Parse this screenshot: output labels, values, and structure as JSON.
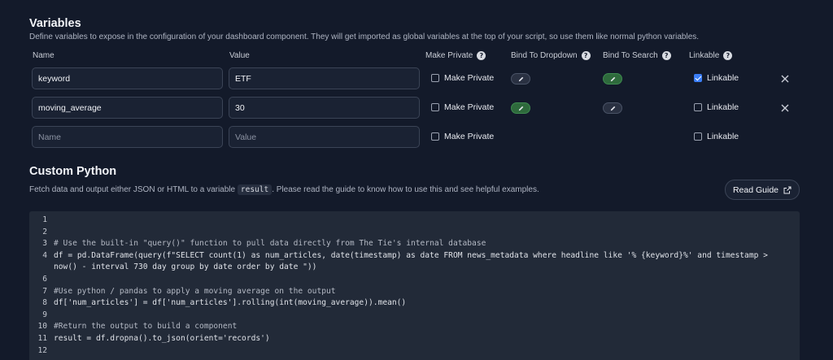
{
  "variables": {
    "title": "Variables",
    "description": "Define variables to expose in the configuration of your dashboard component. They will get imported as global variables at the top of your script, so use them like normal python variables.",
    "columns": {
      "name": "Name",
      "value": "Value",
      "make_private": "Make Private",
      "bind_dropdown": "Bind To Dropdown",
      "bind_search": "Bind To Search",
      "linkable": "Linkable"
    },
    "rows": [
      {
        "name": "keyword",
        "value": "ETF",
        "make_private_label": "Make Private",
        "make_private": false,
        "bind_dropdown": false,
        "bind_search": true,
        "linkable_label": "Linkable",
        "linkable": true
      },
      {
        "name": "moving_average",
        "value": "30",
        "make_private_label": "Make Private",
        "make_private": false,
        "bind_dropdown": true,
        "bind_search": false,
        "linkable_label": "Linkable",
        "linkable": false
      }
    ],
    "new_row": {
      "name_placeholder": "Name",
      "value_placeholder": "Value",
      "make_private_label": "Make Private",
      "linkable_label": "Linkable"
    }
  },
  "custom_python": {
    "title": "Custom Python",
    "desc_before": "Fetch data and output either JSON or HTML to a variable",
    "desc_code": "result",
    "desc_after": ". Please read the guide to know how to use this and see helpful examples.",
    "read_guide_label": "Read Guide"
  },
  "code": {
    "lines": [
      {
        "n": "1",
        "text": ""
      },
      {
        "n": "2",
        "text": ""
      },
      {
        "n": "3",
        "text": "# Use the built-in \"query()\" function to pull data directly from The Tie's internal database"
      },
      {
        "n": "4",
        "text": "df = pd.DataFrame(query(f\"SELECT count(1) as num_articles, date(timestamp) as date FROM news_metadata where headline like '% {keyword}%' and timestamp >"
      },
      {
        "n": "",
        "text": "now() - interval 730 day group by date order by date \"))"
      },
      {
        "n": "6",
        "text": ""
      },
      {
        "n": "7",
        "text": "#Use python / pandas to apply a moving average on the output"
      },
      {
        "n": "8",
        "text": "df['num_articles'] = df['num_articles'].rolling(int(moving_average)).mean()"
      },
      {
        "n": "9",
        "text": ""
      },
      {
        "n": "10",
        "text": "#Return the output to build a component"
      },
      {
        "n": "11",
        "text": "result = df.dropna().to_json(orient='records')"
      },
      {
        "n": "12",
        "text": ""
      }
    ]
  }
}
